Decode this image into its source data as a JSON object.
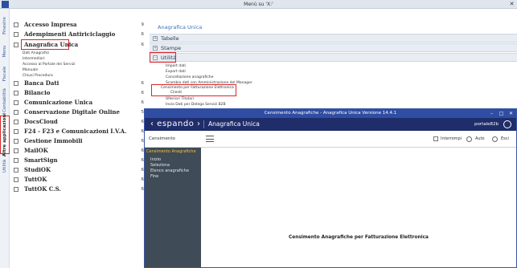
{
  "titlebar": {
    "title": "Menù su 'X:'",
    "close": "✕"
  },
  "sidetabs": [
    "Finestre",
    "Menu",
    "Fiscale",
    "Contabilità",
    "Altre applicazioni",
    "Utilità"
  ],
  "menu": {
    "items": [
      {
        "label": "Accesso Impresa",
        "num": "9"
      },
      {
        "label": "Adempimenti Antiriciclaggio",
        "num": "6"
      },
      {
        "label": "Anagrafica Unica",
        "num": "6"
      },
      {
        "label": "Banca Dati",
        "num": "6"
      },
      {
        "label": "Bilancio",
        "num": "6"
      },
      {
        "label": "Comunicazione Unica",
        "num": "6"
      },
      {
        "label": "Conservazione Digitale Online",
        "num": "5"
      },
      {
        "label": "DocsCloud",
        "num": "6"
      },
      {
        "label": "F24 - F23 e Comunicazioni I.V.A.",
        "num": "6"
      },
      {
        "label": "Gestione Immobili",
        "num": "6"
      },
      {
        "label": "MailOK",
        "num": "6"
      },
      {
        "label": "SmartSign",
        "num": "6"
      },
      {
        "label": "StudiOK",
        "num": "6"
      },
      {
        "label": "TuttOK",
        "num": "6"
      },
      {
        "label": "TuttOK C.S.",
        "num": "6"
      }
    ],
    "anagrafica_sub": [
      "Dati Anagrafici",
      "Intermediari",
      "Accesso al Portale dei Servizi",
      "Manuale",
      "Chiusi Procedura"
    ]
  },
  "right": {
    "heading": "Anagrafica Unica",
    "sections": [
      "Tabelle",
      "Stampe",
      "Utilità"
    ],
    "utilita_items": [
      "Import dati",
      "Export dati",
      "Cancellazione anagrafiche",
      "Scambio dati con Amministrazione del Manager",
      "Censimento per Fatturazione Elettronica",
      "Clienti",
      "Ulteriori Titolari",
      "Invio Dati per Delega Servizi B2B"
    ]
  },
  "window": {
    "title": "Censimento Anagrafiche - Anagrafica Unica Versione 14.4.1",
    "brand": "‹ espando ›",
    "app_name": "Anagrafica Unica",
    "user": "portale82b",
    "left_header": "Censimento Anagrafiche",
    "nav_title": "Censimento Anagrafiche",
    "nav_items": [
      "Inizio",
      "Seleziona",
      "Elenco anagrafiche",
      "Fine"
    ],
    "toolbar": {
      "interrompi": "Interrompi",
      "auto": "Auto",
      "esci": "Esci"
    },
    "main_message": "Censimento Anagrafiche per Fatturazione Elettronica"
  }
}
